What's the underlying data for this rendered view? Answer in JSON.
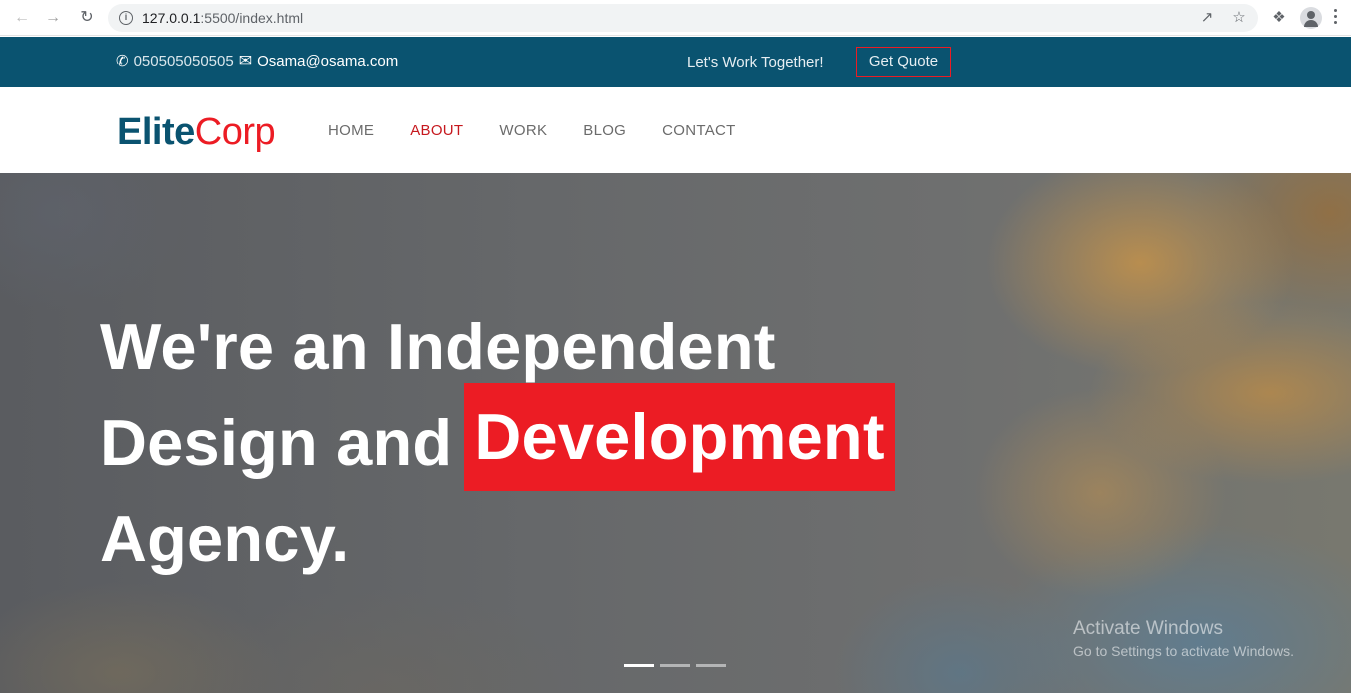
{
  "browser": {
    "url_host": "127.0.0.1",
    "url_rest": ":5500/index.html"
  },
  "topbar": {
    "phone": "050505050505",
    "email": "Osama@osama.com",
    "tagline": "Let's Work Together!",
    "quote_button": "Get Quote"
  },
  "logo": {
    "part1": "Elite",
    "part2": "Corp"
  },
  "menu": {
    "items": [
      {
        "label": "HOME"
      },
      {
        "label": "ABOUT"
      },
      {
        "label": "WORK"
      },
      {
        "label": "BLOG"
      },
      {
        "label": "CONTACT"
      }
    ],
    "active_index": 1
  },
  "hero": {
    "line1": "We're an Independent",
    "line2_prefix": "Design and",
    "line2_highlight": "Development",
    "line3": "Agency.",
    "slides": 3,
    "active_slide": 0
  },
  "watermark": {
    "title": "Activate Windows",
    "subtitle": "Go to Settings to activate Windows."
  },
  "colors": {
    "primary": "#0a5370",
    "accent": "#ec1c24"
  }
}
